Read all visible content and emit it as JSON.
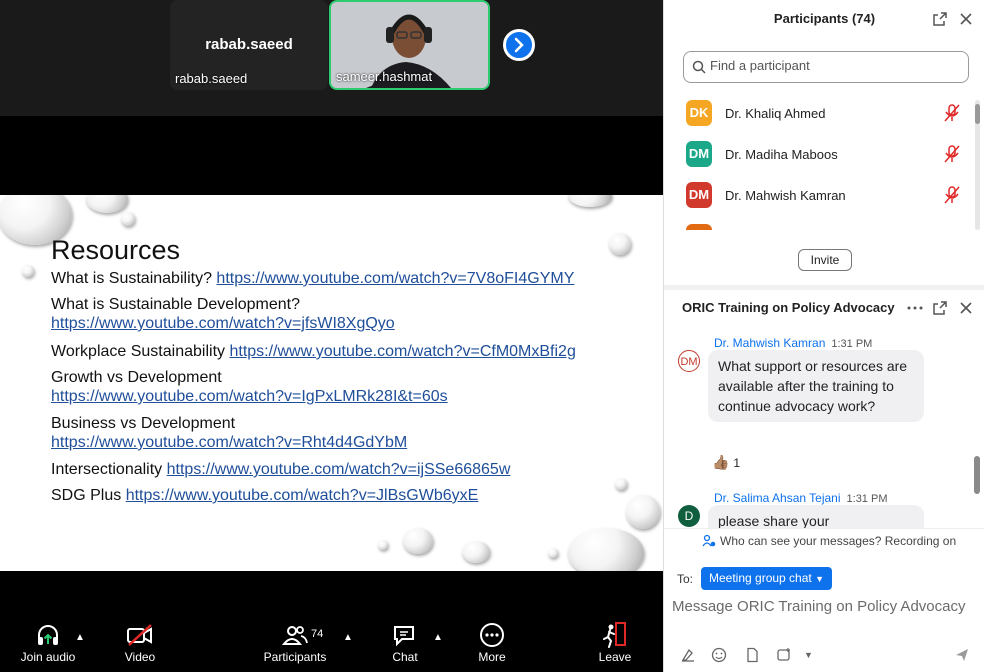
{
  "gallery": {
    "tiles": [
      {
        "big_name": "rabab.saeed",
        "label": "rabab.saeed"
      },
      {
        "label": "sameer.hashmat"
      }
    ]
  },
  "slide": {
    "title": "Resources",
    "lines": [
      {
        "label": "What is Sustainability?",
        "url": "https://www.youtube.com/watch?v=7V8oFI4GYMY"
      },
      {
        "label": "What is Sustainable Development?",
        "url": "https://www.youtube.com/watch?v=jfsWI8XgQyo"
      },
      {
        "label": "Workplace Sustainability",
        "url": "https://www.youtube.com/watch?v=CfM0MxBfi2g"
      },
      {
        "label": "Growth vs Development",
        "url": "https://www.youtube.com/watch?v=IgPxLMRk28I&t=60s"
      },
      {
        "label": "Business vs Development",
        "url": "https://www.youtube.com/watch?v=Rht4d4GdYbM"
      },
      {
        "label": "Intersectionality",
        "url": "https://www.youtube.com/watch?v=ijSSe66865w"
      },
      {
        "label": "SDG Plus",
        "url": "https://www.youtube.com/watch?v=JlBsGWb6yxE"
      }
    ]
  },
  "toolbar": {
    "join_audio": "Join audio",
    "video": "Video",
    "participants": "Participants",
    "participants_count": "74",
    "chat": "Chat",
    "more": "More",
    "leave": "Leave"
  },
  "participants": {
    "title": "Participants (74)",
    "search_placeholder": "Find a participant",
    "invite": "Invite",
    "list": [
      {
        "initials": "DK",
        "name": "Dr. Khaliq Ahmed",
        "color": "#f5a623"
      },
      {
        "initials": "DM",
        "name": "Dr. Madiha Maboos",
        "color": "#1aa888"
      },
      {
        "initials": "DM",
        "name": "Dr. Mahwish Kamran",
        "color": "#d0392b"
      }
    ]
  },
  "chat": {
    "title": "ORIC Training on Policy Advocacy",
    "messages": [
      {
        "avatar": "DM",
        "sender": "Dr. Mahwish Kamran",
        "time": "1:31 PM",
        "text": "What support or resources are available after the training to continue advocacy work?",
        "reaction": "👍🏽",
        "reaction_count": "1"
      },
      {
        "avatar": "D",
        "sender": "Dr. Salima Ahsan Tejani",
        "time": "1:31 PM",
        "text": "please share your"
      }
    ],
    "notice": "Who can see your messages? Recording on",
    "to_label": "To:",
    "to_value": "Meeting group chat",
    "input_placeholder": "Message ORIC Training on Policy Advocacy"
  }
}
